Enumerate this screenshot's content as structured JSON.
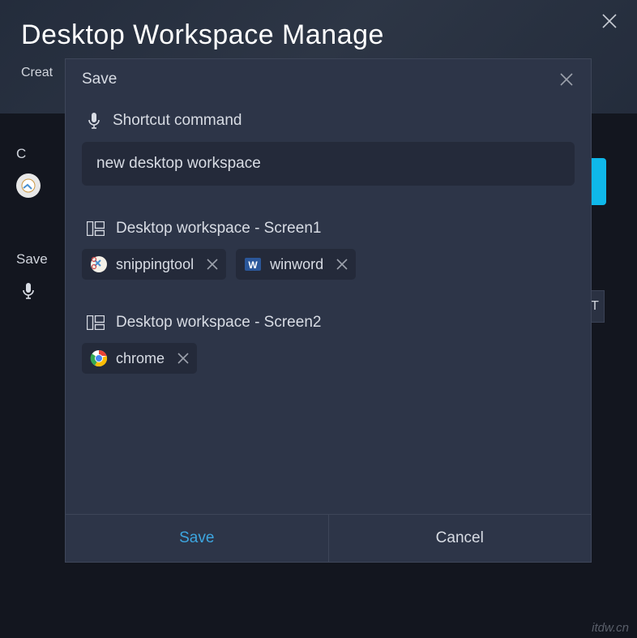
{
  "main": {
    "title": "Desktop Workspace Manage",
    "subtitle": "Creat"
  },
  "bg": {
    "cLabel": "C",
    "saveLabel": "Save",
    "rightGlyph": "T"
  },
  "dialog": {
    "title": "Save",
    "shortcut_label": "Shortcut command",
    "shortcut_value": "new desktop workspace",
    "screens": [
      {
        "label": "Desktop workspace - Screen1",
        "apps": [
          {
            "name": "snippingtool",
            "icon": "snipping"
          },
          {
            "name": "winword",
            "icon": "word"
          }
        ]
      },
      {
        "label": "Desktop workspace - Screen2",
        "apps": [
          {
            "name": "chrome",
            "icon": "chrome"
          }
        ]
      }
    ],
    "save_label": "Save",
    "cancel_label": "Cancel"
  },
  "watermark": "itdw.cn"
}
